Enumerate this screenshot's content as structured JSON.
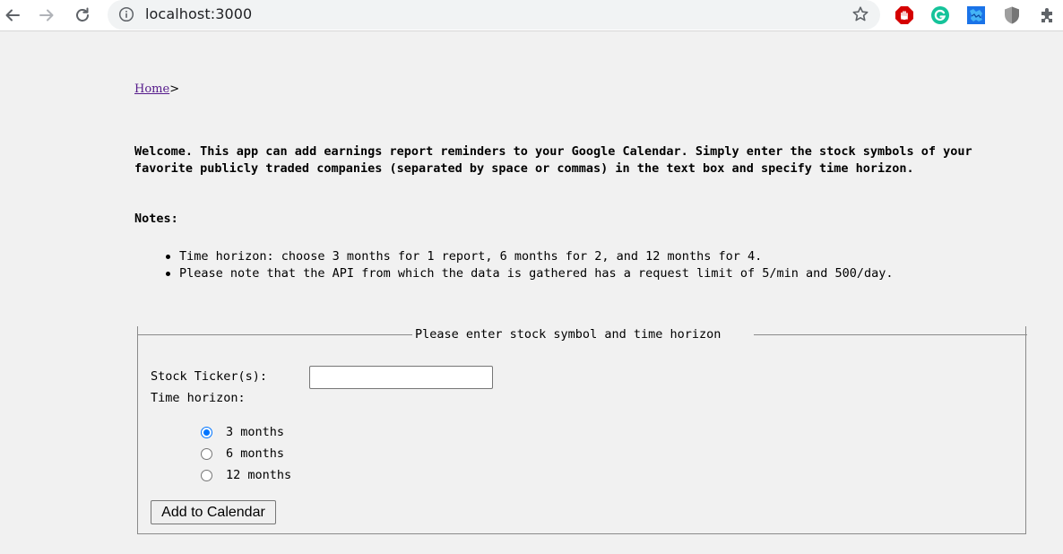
{
  "browser": {
    "url": "localhost:3000",
    "icons": {
      "back": "back-arrow-icon",
      "forward": "forward-arrow-icon",
      "reload": "reload-icon",
      "info": "info-icon",
      "bookmark": "star-icon",
      "extensions": [
        "adblock-icon",
        "grammarly-icon",
        "puzzle-blue-extension-icon",
        "shield-extension-icon",
        "extensions-puzzle-icon"
      ]
    },
    "colors": {
      "adblock": "#d50000",
      "grammarly": "#15c39a",
      "blue_ext": "#1a73e8",
      "shield": "#9e9e9e"
    }
  },
  "breadcrumb": {
    "home": "Home",
    "separator": ">"
  },
  "intro": {
    "welcome": "Welcome. This app can add earnings report reminders to your Google Calendar. Simply enter the stock symbols of your favorite publicly traded companies (separated by space or commas) in the text box and specify time horizon.",
    "notes_title": "Notes:",
    "notes": [
      "Time horizon: choose 3 months for 1 report, 6 months for 2, and 12 months for 4.",
      "Please note that the API from which the data is gathered has a request limit of 5/min and 500/day."
    ]
  },
  "form": {
    "legend": "Please enter stock symbol and time horizon",
    "ticker_label": "Stock Ticker(s):",
    "ticker_value": "",
    "horizon_label": "Time horizon:",
    "options": [
      {
        "label": "3 months",
        "checked": true
      },
      {
        "label": "6 months",
        "checked": false
      },
      {
        "label": "12 months",
        "checked": false
      }
    ],
    "submit_label": "Add to Calendar"
  }
}
